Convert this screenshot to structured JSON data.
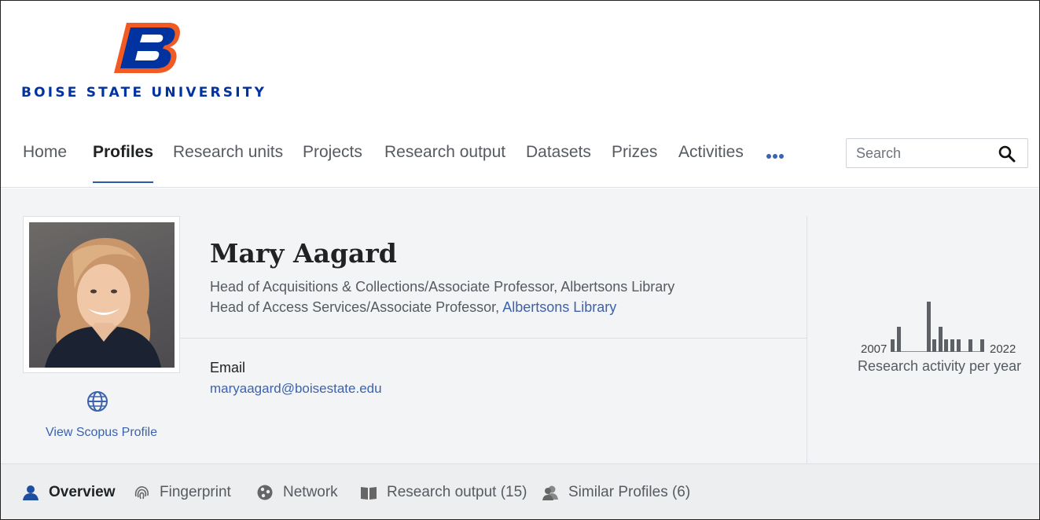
{
  "brand": {
    "university_name": "BOISE STATE UNIVERSITY",
    "logo_letter": "B",
    "blue": "#0033a0",
    "orange": "#f15a22"
  },
  "nav": {
    "items": [
      {
        "label": "Home",
        "active": false
      },
      {
        "label": "Profiles",
        "active": true
      },
      {
        "label": "Research units",
        "active": false
      },
      {
        "label": "Projects",
        "active": false
      },
      {
        "label": "Research output",
        "active": false
      },
      {
        "label": "Datasets",
        "active": false
      },
      {
        "label": "Prizes",
        "active": false
      },
      {
        "label": "Activities",
        "active": false
      }
    ],
    "more_icon": "more-dots-icon"
  },
  "search": {
    "placeholder": "Search",
    "value": "",
    "icon": "search-icon"
  },
  "profile": {
    "name": "Mary Aagard",
    "roles": [
      {
        "title": "Head of Acquisitions & Collections/Associate Professor, Albertsons Library",
        "unit_link": ""
      },
      {
        "title": "Head of Access Services/Associate Professor, ",
        "unit_link": "Albertsons Library"
      }
    ],
    "email_label": "Email",
    "email": "maryaagard@boisestate.edu",
    "scopus_link": "View Scopus Profile",
    "accent_link_color": "#3c62ad"
  },
  "chart_data": {
    "type": "bar",
    "title": "",
    "caption": "Research activity per year",
    "x_start_label": "2007",
    "x_end_label": "2022",
    "values": [
      1,
      2,
      0,
      0,
      0,
      0,
      4,
      1,
      2,
      1,
      1,
      1,
      0,
      1,
      0,
      1
    ],
    "bar_color": "#5d6166"
  },
  "tabs": [
    {
      "label": "Overview",
      "icon": "person-icon",
      "active": true
    },
    {
      "label": "Fingerprint",
      "icon": "fingerprint-icon",
      "active": false
    },
    {
      "label": "Network",
      "icon": "network-icon",
      "active": false
    },
    {
      "label": "Research output (15)",
      "icon": "book-icon",
      "active": false
    },
    {
      "label": "Similar Profiles (6)",
      "icon": "similar-profiles-icon",
      "active": false
    }
  ]
}
